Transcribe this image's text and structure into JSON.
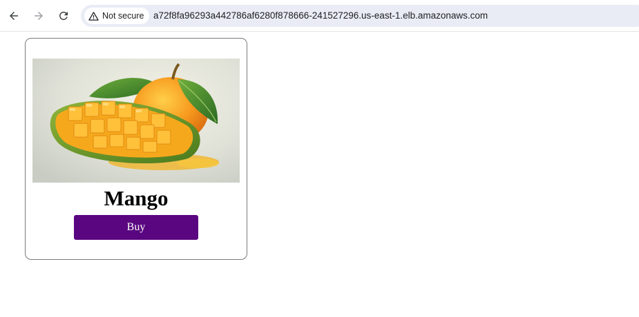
{
  "browser": {
    "security_label": "Not secure",
    "url": "a72f8fa96293a442786af6280f878666-241527296.us-east-1.elb.amazonaws.com",
    "icons": [
      "back-arrow-icon",
      "forward-arrow-icon",
      "reload-icon",
      "warning-triangle-icon"
    ]
  },
  "product": {
    "name": "Mango",
    "buy_label": "Buy",
    "image_subject": "mango-image",
    "colors": {
      "button": "#5a0680",
      "border": "#7a7a7a"
    }
  }
}
